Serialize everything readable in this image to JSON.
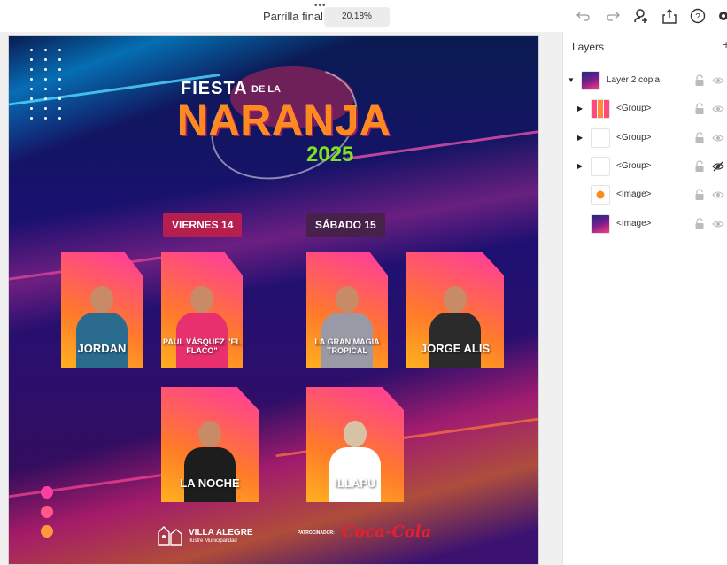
{
  "header": {
    "document_title": "Parrilla final",
    "more_dots": "•••",
    "zoom": "20,18%",
    "icons": [
      "undo-icon",
      "redo-icon",
      "invite-user-icon",
      "share-icon",
      "help-icon",
      "settings-icon"
    ]
  },
  "poster": {
    "title_fiesta": "FIESTA",
    "title_de_la": "DE LA",
    "title_naranja": "NARANJA",
    "title_year": "2025",
    "days": [
      {
        "label": "VIERNES 14"
      },
      {
        "label": "SÁBADO 15"
      }
    ],
    "artists": [
      {
        "name": "JORDAN"
      },
      {
        "name": "PAUL VÁSQUEZ \"EL FLACO\""
      },
      {
        "name": "LA GRAN MAGIA TROPICAL"
      },
      {
        "name": "JORGE ALIS"
      },
      {
        "name": "LA NOCHE"
      },
      {
        "name": "ILLAPU"
      }
    ],
    "footer_brand": "VILLA ALEGRE",
    "footer_sub": "Ilustre Municipalidad",
    "sponsor_label": "PATROCINADOR:",
    "sponsor_brand": "Coca-Cola",
    "colors": {
      "accent_orange": "#ff8a1c",
      "accent_green": "#7ce31d",
      "badge_red": "#b61e4f",
      "badge_dark": "#47214a"
    }
  },
  "layers": {
    "title": "Layers",
    "add": "+",
    "items": [
      {
        "name": "Layer 2 copia",
        "expanded": true,
        "visible": true
      },
      {
        "name": "<Group>",
        "expanded": false,
        "visible": true
      },
      {
        "name": "<Group>",
        "expanded": false,
        "visible": true
      },
      {
        "name": "<Group>",
        "expanded": false,
        "visible": false
      },
      {
        "name": "<Image>",
        "visible": true
      },
      {
        "name": "<Image>",
        "visible": true
      }
    ]
  }
}
